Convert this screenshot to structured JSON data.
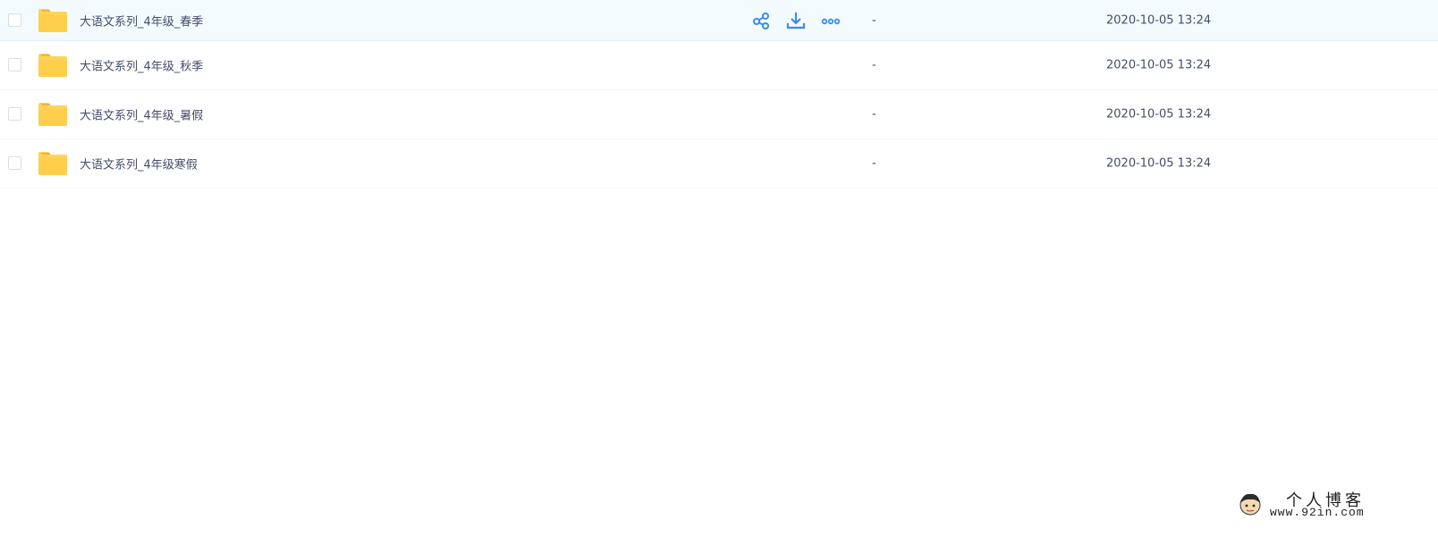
{
  "files": [
    {
      "name": "大语文系列_4年级_春季",
      "size": "-",
      "modified": "2020-10-05 13:24",
      "hovered": true
    },
    {
      "name": "大语文系列_4年级_秋季",
      "size": "-",
      "modified": "2020-10-05 13:24",
      "hovered": false
    },
    {
      "name": "大语文系列_4年级_暑假",
      "size": "-",
      "modified": "2020-10-05 13:24",
      "hovered": false
    },
    {
      "name": "大语文系列_4年级寒假",
      "size": "-",
      "modified": "2020-10-05 13:24",
      "hovered": false
    }
  ],
  "row_actions": {
    "icons": [
      "share-icon",
      "download-icon",
      "more-icon"
    ]
  },
  "watermark": {
    "title": "个人博客",
    "url": "www.92in.com"
  },
  "colors": {
    "accent": "#3b8cf0",
    "folder": "#ffd258",
    "hover_row": "#f4fbff",
    "text": "#424e67"
  }
}
